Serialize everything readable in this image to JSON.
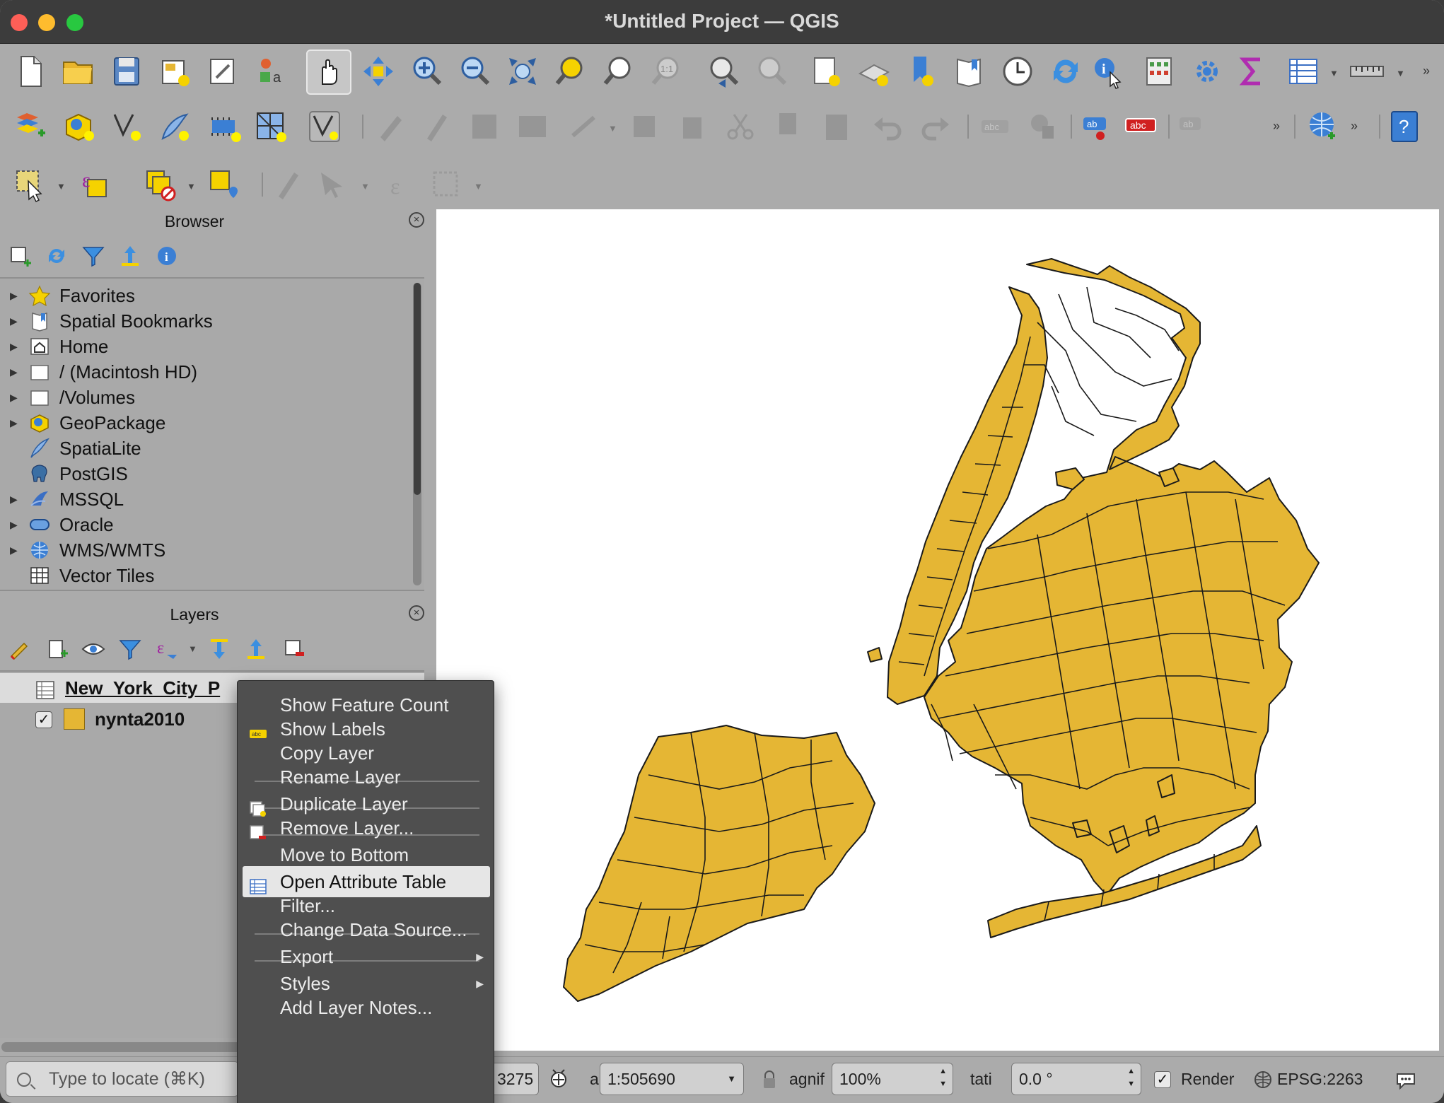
{
  "window": {
    "title": "*Untitled Project — QGIS"
  },
  "browser": {
    "title": "Browser",
    "items": [
      {
        "label": "Favorites",
        "expandable": true,
        "icon": "star-icon"
      },
      {
        "label": "Spatial Bookmarks",
        "expandable": true,
        "icon": "bookmark-icon"
      },
      {
        "label": "Home",
        "expandable": true,
        "icon": "home-icon"
      },
      {
        "label": "/ (Macintosh HD)",
        "expandable": true,
        "icon": "folder-icon"
      },
      {
        "label": "/Volumes",
        "expandable": true,
        "icon": "folder-icon"
      },
      {
        "label": "GeoPackage",
        "expandable": true,
        "icon": "geopackage-icon"
      },
      {
        "label": "SpatiaLite",
        "expandable": false,
        "icon": "feather-icon"
      },
      {
        "label": "PostGIS",
        "expandable": false,
        "icon": "elephant-icon"
      },
      {
        "label": "MSSQL",
        "expandable": true,
        "icon": "mssql-icon"
      },
      {
        "label": "Oracle",
        "expandable": true,
        "icon": "oracle-icon"
      },
      {
        "label": "WMS/WMTS",
        "expandable": true,
        "icon": "globe-icon"
      },
      {
        "label": "Vector Tiles",
        "expandable": false,
        "icon": "grid-icon"
      }
    ]
  },
  "layers": {
    "title": "Layers",
    "items": [
      {
        "label": "New_York_City_P",
        "type": "table",
        "selected": true
      },
      {
        "label": "nynta2010",
        "type": "polygon",
        "checked": true,
        "color": "#e5b634"
      }
    ]
  },
  "context_menu": {
    "items": [
      {
        "label": "Show Feature Count",
        "icon": ""
      },
      {
        "label": "Show Labels",
        "icon": "labels-icon"
      },
      {
        "label": "Copy Layer",
        "icon": ""
      },
      {
        "label": "Rename Layer",
        "icon": ""
      },
      {
        "label": "Duplicate Layer",
        "icon": "duplicate-layer-icon"
      },
      {
        "label": "Remove Layer...",
        "icon": "remove-layer-icon"
      },
      {
        "label": "Move to Bottom",
        "icon": ""
      },
      {
        "label": "Open Attribute Table",
        "icon": "table-icon",
        "highlighted": true
      },
      {
        "label": "Filter...",
        "icon": ""
      },
      {
        "label": "Change Data Source...",
        "icon": ""
      },
      {
        "label": "Export",
        "icon": "",
        "submenu": true
      },
      {
        "label": "Styles",
        "icon": "",
        "submenu": true
      },
      {
        "label": "Add Layer Notes...",
        "icon": ""
      }
    ]
  },
  "statusbar": {
    "locate_placeholder": "Type to locate (⌘K)",
    "coordinate": "3275",
    "scale_label": "a",
    "scale": "1:505690",
    "magnifier_label": "agnif",
    "magnifier": "100%",
    "rotation_label": "tati",
    "rotation": "0.0 °",
    "render_label": "Render",
    "crs": "EPSG:2263"
  },
  "colors": {
    "fill": "#e5b634",
    "stroke": "#1a1a1a",
    "accent_highlight": "#e6e6e6"
  }
}
